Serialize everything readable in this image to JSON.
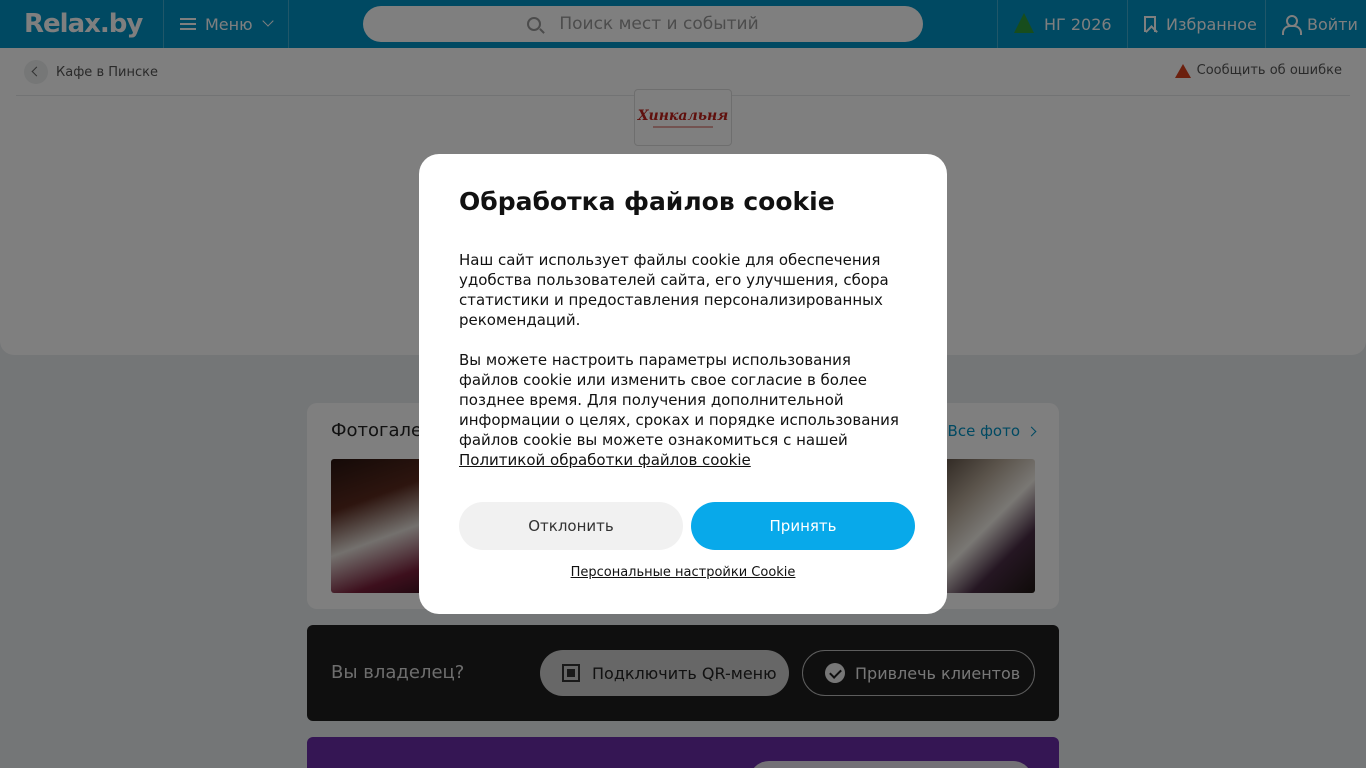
{
  "header": {
    "logo": "Relax.by",
    "menu_label": "Меню",
    "search_placeholder": "Поиск мест и событий",
    "ny_label": "НГ 2026",
    "favorites_label": "Избранное",
    "login_label": "Войти"
  },
  "breadcrumb": {
    "back_label": "Кафе в Пинске"
  },
  "report_label": "Сообщить об ошибке",
  "place_logo_text": "Хинкальня",
  "gallery": {
    "title": "Фотогалерея",
    "all_photos": "Все фото"
  },
  "owner": {
    "label": "Вы владелец?",
    "qr_button": "Подключить QR-меню",
    "clients_button": "Привлечь клиентов"
  },
  "cookie_modal": {
    "title": "Обработка файлов cookie",
    "paragraph1": "Наш сайт использует файлы cookie для обеспечения удобства пользователей сайта, его улучшения, сбора статистики и предоставления персонализированных рекомендаций.",
    "paragraph2": "Вы можете настроить параметры использования файлов cookie или изменить свое согласие в более позднее время. Для получения дополнительной информации о целях, сроках и порядке использования файлов cookie вы можете ознакомиться с нашей",
    "policy_link": "Политикой обработки файлов cookie",
    "decline_button": "Отклонить",
    "accept_button": "Принять",
    "personal_settings_link": "Персональные настройки Cookie"
  },
  "colors": {
    "header_bg": "#0093c4",
    "accept_bg": "#08a9ea",
    "warning": "#d9401c",
    "promo_bg": "#6b2da8"
  }
}
